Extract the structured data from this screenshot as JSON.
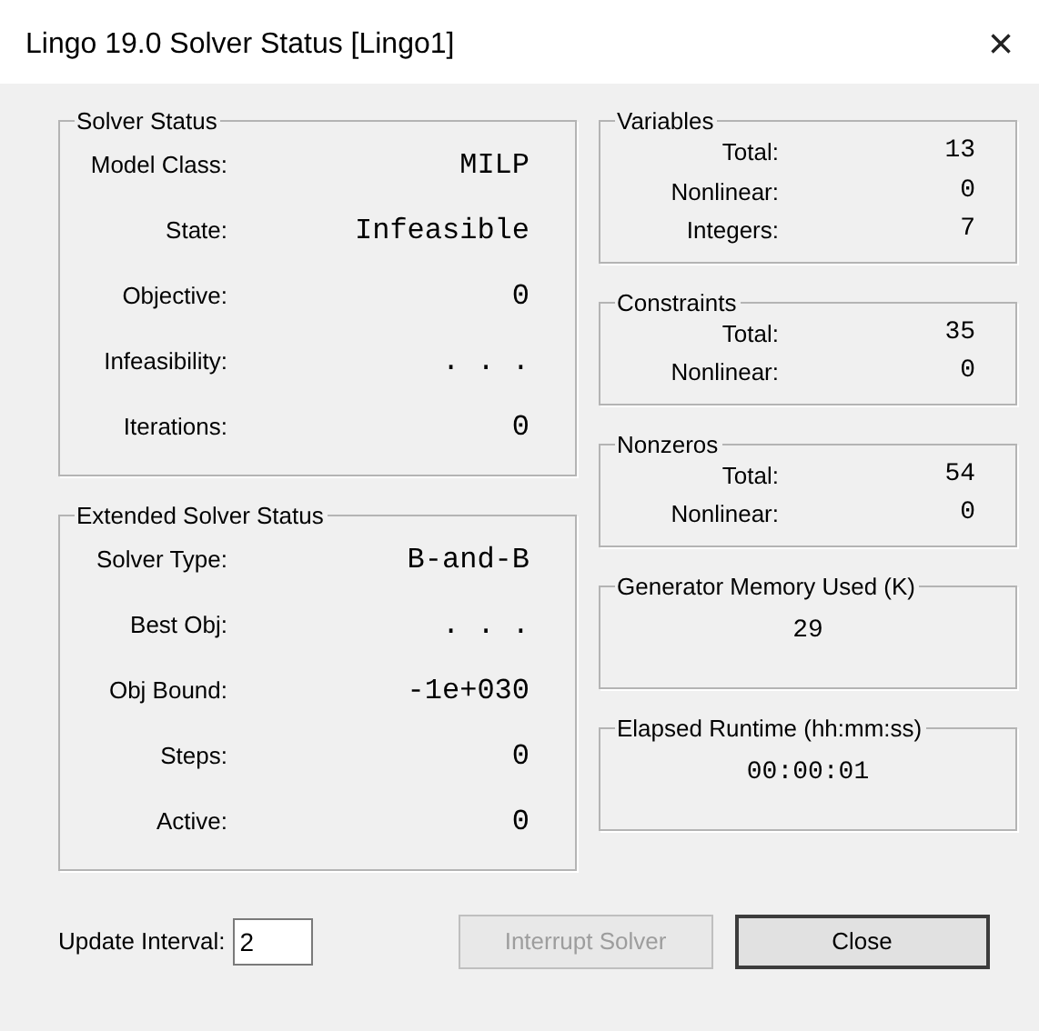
{
  "window": {
    "title": "Lingo 19.0 Solver Status [Lingo1]",
    "close_glyph": "×"
  },
  "left_groups": [
    {
      "title": "Solver Status",
      "rows": [
        {
          "label": "Model Class:",
          "value": "MILP"
        },
        {
          "label": "State:",
          "value": "Infeasible"
        },
        {
          "label": "Objective:",
          "value": "0"
        },
        {
          "label": "Infeasibility:",
          "value": ". . ."
        },
        {
          "label": "Iterations:",
          "value": "0"
        }
      ]
    },
    {
      "title": "Extended Solver Status",
      "rows": [
        {
          "label": "Solver Type:",
          "value": "B-and-B"
        },
        {
          "label": "Best Obj:",
          "value": ". . ."
        },
        {
          "label": "Obj Bound:",
          "value": "-1e+030"
        },
        {
          "label": "Steps:",
          "value": "0"
        },
        {
          "label": "Active:",
          "value": "0"
        }
      ]
    }
  ],
  "right_groups": [
    {
      "kind": "table",
      "title": "Variables",
      "rows": [
        {
          "label": "Total:",
          "value": "13"
        },
        {
          "label": "Nonlinear:",
          "value": "0"
        },
        {
          "label": "Integers:",
          "value": "7"
        }
      ]
    },
    {
      "kind": "table",
      "title": "Constraints",
      "rows": [
        {
          "label": "Total:",
          "value": "35"
        },
        {
          "label": "Nonlinear:",
          "value": "0"
        }
      ]
    },
    {
      "kind": "table",
      "title": "Nonzeros",
      "rows": [
        {
          "label": "Total:",
          "value": "54"
        },
        {
          "label": "Nonlinear:",
          "value": "0"
        }
      ]
    },
    {
      "kind": "single",
      "title": "Generator Memory Used (K)",
      "value": "29"
    },
    {
      "kind": "single",
      "title": "Elapsed Runtime (hh:mm:ss)",
      "value": "00:00:01"
    }
  ],
  "update_interval": {
    "label": "Update Interval:",
    "value": "2"
  },
  "buttons": [
    {
      "label": "Interrupt Solver",
      "disabled": true,
      "default": false
    },
    {
      "label": "Close",
      "disabled": false,
      "default": true
    }
  ]
}
